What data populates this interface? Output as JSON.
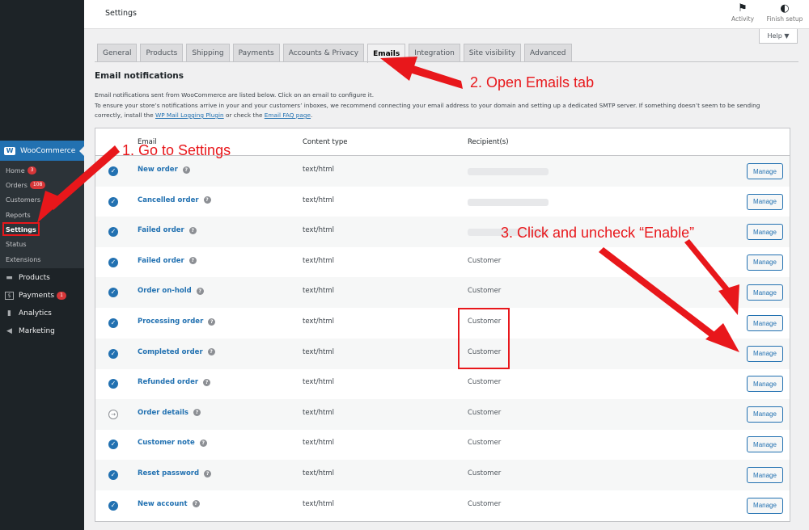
{
  "topbar": {
    "title": "Settings",
    "activity_label": "Activity",
    "activity_icon": "flag-icon",
    "finish_label": "Finish setup",
    "finish_icon": "half-circle-icon",
    "help_label": "Help ▼"
  },
  "sidebar": {
    "brand": "WooCommerce",
    "brand_icon": "woo-logo-icon",
    "sub_items": [
      {
        "label": "Home",
        "count": "3"
      },
      {
        "label": "Orders",
        "count": "108"
      },
      {
        "label": "Customers"
      },
      {
        "label": "Reports"
      },
      {
        "label": "Settings"
      },
      {
        "label": "Status"
      },
      {
        "label": "Extensions"
      }
    ],
    "main_items": [
      {
        "label": "Products",
        "icon": "archive-icon"
      },
      {
        "label": "Payments",
        "count": "1",
        "icon": "dollar-icon"
      },
      {
        "label": "Analytics",
        "icon": "bar-chart-icon"
      },
      {
        "label": "Marketing",
        "icon": "megaphone-icon"
      }
    ]
  },
  "tabs": [
    {
      "label": "General"
    },
    {
      "label": "Products"
    },
    {
      "label": "Shipping"
    },
    {
      "label": "Payments"
    },
    {
      "label": "Accounts & Privacy"
    },
    {
      "label": "Emails",
      "active": true
    },
    {
      "label": "Integration"
    },
    {
      "label": "Site visibility"
    },
    {
      "label": "Advanced"
    }
  ],
  "section": {
    "title": "Email notifications",
    "line1": "Email notifications sent from WooCommerce are listed below. Click on an email to configure it.",
    "line2": "To ensure your store’s notifications arrive in your and your customers’ inboxes, we recommend connecting your email address to your domain and setting up a dedicated SMTP server. If something doesn’t seem to be sending",
    "line3_pre": "correctly, install the ",
    "line3_link1": "WP Mail Logging Plugin",
    "line3_mid": " or check the ",
    "line3_link2": "Email FAQ page",
    "line3_post": "."
  },
  "table": {
    "headers": {
      "email": "Email",
      "content_type": "Content type",
      "recipients": "Recipient(s)"
    },
    "manage_label": "Manage",
    "rows": [
      {
        "name": "New order",
        "type": "text/html",
        "recipient": "",
        "status": "enabled"
      },
      {
        "name": "Cancelled order",
        "type": "text/html",
        "recipient": "",
        "status": "enabled"
      },
      {
        "name": "Failed order",
        "type": "text/html",
        "recipient": "",
        "status": "enabled"
      },
      {
        "name": "Failed order",
        "type": "text/html",
        "recipient": "Customer",
        "status": "enabled"
      },
      {
        "name": "Order on-hold",
        "type": "text/html",
        "recipient": "Customer",
        "status": "enabled"
      },
      {
        "name": "Processing order",
        "type": "text/html",
        "recipient": "Customer",
        "status": "enabled"
      },
      {
        "name": "Completed order",
        "type": "text/html",
        "recipient": "Customer",
        "status": "enabled"
      },
      {
        "name": "Refunded order",
        "type": "text/html",
        "recipient": "Customer",
        "status": "enabled"
      },
      {
        "name": "Order details",
        "type": "text/html",
        "recipient": "Customer",
        "status": "manual"
      },
      {
        "name": "Customer note",
        "type": "text/html",
        "recipient": "Customer",
        "status": "enabled"
      },
      {
        "name": "Reset password",
        "type": "text/html",
        "recipient": "Customer",
        "status": "enabled"
      },
      {
        "name": "New account",
        "type": "text/html",
        "recipient": "Customer",
        "status": "enabled"
      }
    ]
  },
  "annotations": {
    "step1": "1. Go to Settings",
    "step2": "2. Open Emails tab",
    "step3": "3. Click and uncheck “Enable”",
    "color": "#e8171b"
  },
  "colors": {
    "sidebar_bg": "#1d2327",
    "accent": "#2271b1",
    "badge": "#d63638"
  }
}
